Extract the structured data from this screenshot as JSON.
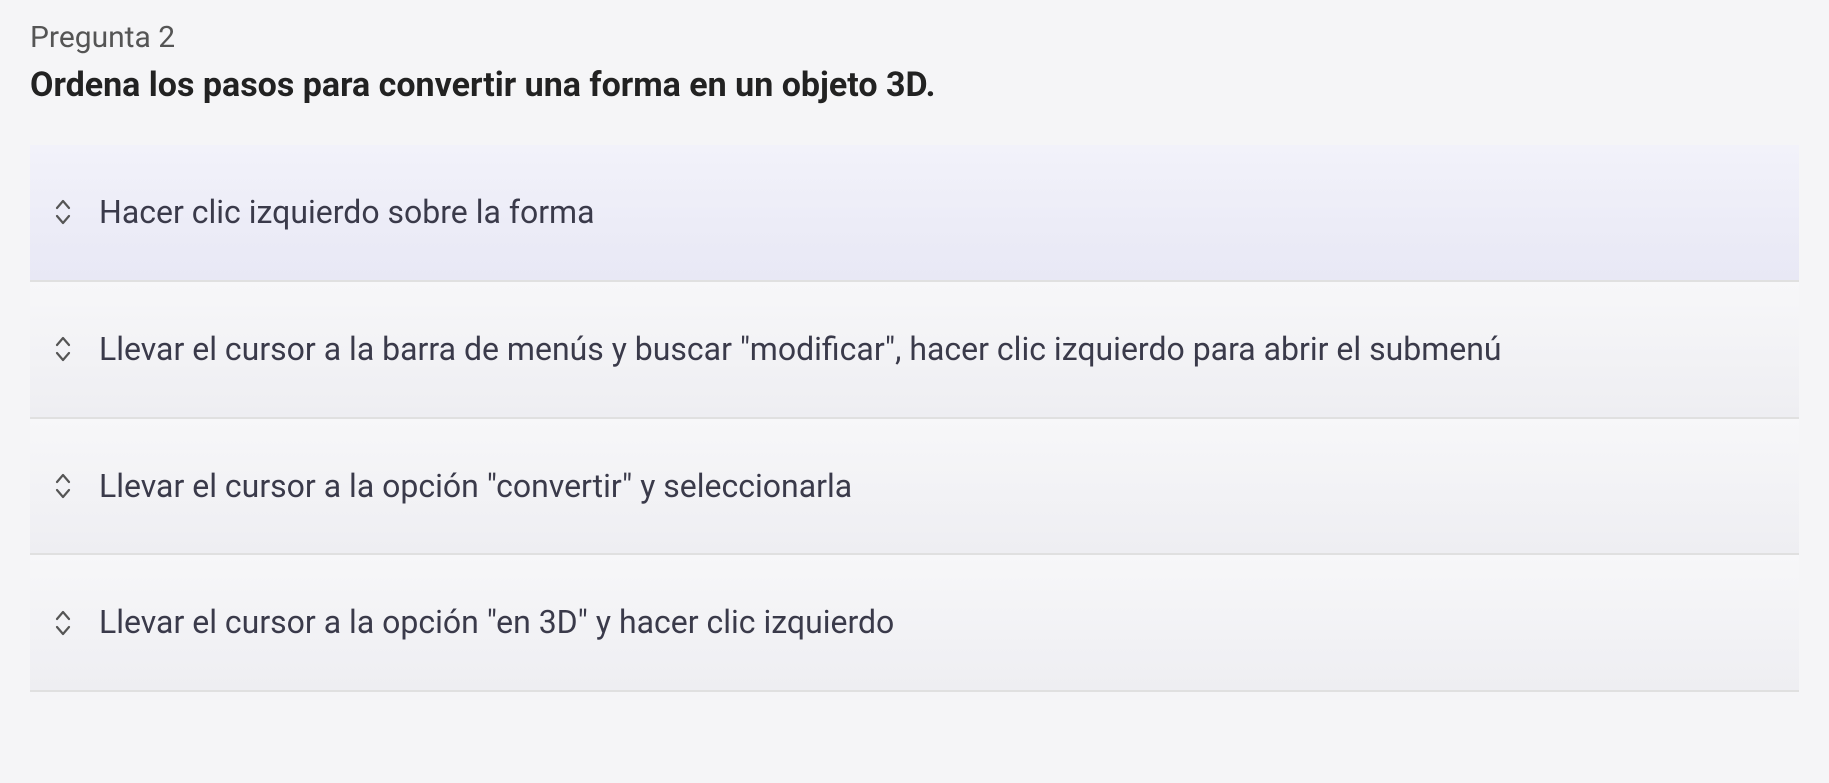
{
  "question": {
    "number": "Pregunta 2",
    "text": "Ordena los pasos para convertir una forma en un objeto 3D."
  },
  "items": [
    {
      "text": "Hacer clic izquierdo sobre la forma"
    },
    {
      "text": "Llevar el cursor a la barra de menús y buscar \"modificar\", hacer clic izquierdo para abrir el submenú"
    },
    {
      "text": "Llevar el cursor a la opción \"convertir\" y seleccionarla"
    },
    {
      "text": "Llevar el cursor a la opción \"en 3D\" y hacer clic izquierdo"
    }
  ]
}
